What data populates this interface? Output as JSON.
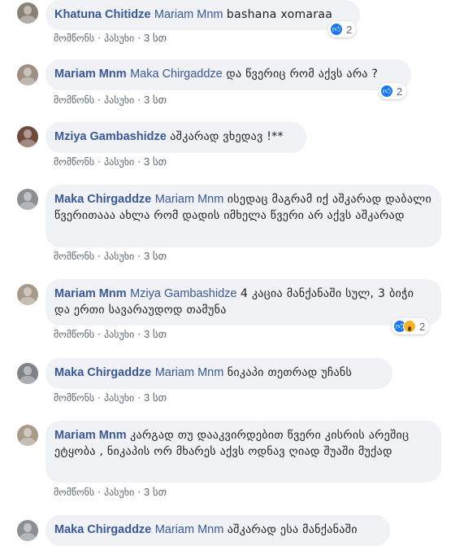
{
  "actions": {
    "like": "მომწონს",
    "reply": "პასუხი",
    "sep": "·"
  },
  "comments": [
    {
      "author": "Khatuna Chitidze",
      "tag": "Mariam Mnm",
      "text": "bashana xomaraa",
      "time": "3 სთ",
      "reactions": "2"
    },
    {
      "author": "Mariam Mnm",
      "tag": "Maka Chirgaddze",
      "text": "და წვერიც რომ აქვს არა ?",
      "time": "3 სთ",
      "reactions": "2"
    },
    {
      "author": "Mziya Gambashidze",
      "tag": "",
      "text": "აშკარად ვხედავ !**",
      "time": "3 სთ"
    },
    {
      "author": "Maka Chirgaddze",
      "tag": "Mariam Mnm",
      "text": "ისედაც მაგრამ იქ აშკარად დაბალი წვერითააა ახლა რომ დადის იმხელა წვერი არ აქვს აშკარად",
      "time": "3 სთ"
    },
    {
      "author": "Mariam Mnm",
      "tag": "Mziya Gambashidze",
      "text": "4 კაცია მანქანაში სულ, 3 ბიჭი და ერთი სავარაუდოდ თამუნა",
      "time": "3 სთ",
      "reactions": "2"
    },
    {
      "author": "Maka Chirgaddze",
      "tag": "Mariam Mnm",
      "text": "ნიკაპი თეთრად უჩანს",
      "time": "3 სთ"
    },
    {
      "author": "Mariam Mnm",
      "tag": "",
      "text": "კარგად თუ დააკვირდებით წვერი კისრის არეშიც ეტყობა , ნიკაპის ორ მხარეს აქვს ოდნავ ღიად შუაში მუქად",
      "time": "3 სთ"
    },
    {
      "author": "Maka Chirgaddze",
      "tag": "Mariam Mnm",
      "text": "აშკარად ესა მანქანაში",
      "time": ""
    }
  ],
  "colors": {
    "link": "#385898",
    "bubble": "#f0f2f5",
    "meta": "#606770",
    "like": "#1877f2",
    "wow": "#f7b125"
  },
  "icons": {
    "like": "thumbs-up-icon",
    "wow": "wow-face-icon"
  }
}
